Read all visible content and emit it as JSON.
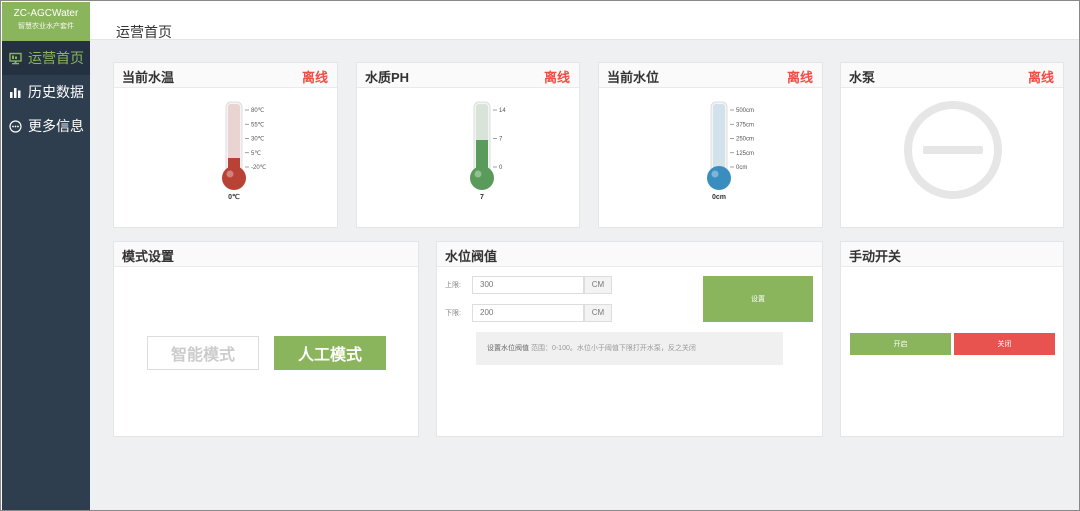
{
  "brand": {
    "title": "ZC-AGCWater",
    "subtitle": "智慧农业水产套件"
  },
  "sidebar": {
    "items": [
      {
        "label": "运营首页",
        "icon": "monitor-icon",
        "active": true
      },
      {
        "label": "历史数据",
        "icon": "bar-chart-icon",
        "active": false
      },
      {
        "label": "更多信息",
        "icon": "more-dots-icon",
        "active": false
      }
    ]
  },
  "header": {
    "page_title": "运营首页"
  },
  "colors": {
    "accent": "#8ab55c",
    "offline": "#f04e45",
    "sidebar": "#2f3e4f",
    "danger_button": "#e8534f"
  },
  "cards": {
    "temp": {
      "title": "当前水温",
      "status": "离线",
      "scale": [
        "80℃",
        "55℃",
        "30℃",
        "5℃",
        "-20℃"
      ],
      "value": "0℃",
      "fill_fraction": 0.2,
      "color": "#b94135"
    },
    "ph": {
      "title": "水质PH",
      "status": "离线",
      "scale": [
        "14",
        "7",
        "0"
      ],
      "value": "7",
      "fill_fraction": 0.5,
      "color": "#5a9a5a"
    },
    "level": {
      "title": "当前水位",
      "status": "离线",
      "scale": [
        "500cm",
        "375cm",
        "250cm",
        "125cm",
        "0cm"
      ],
      "value": "0cm",
      "fill_fraction": 0.0,
      "color": "#3a8dbf"
    },
    "pump": {
      "title": "水泵",
      "status": "离线"
    }
  },
  "mode": {
    "title": "模式设置",
    "smart_label": "智能模式",
    "manual_label": "人工模式"
  },
  "threshold": {
    "title": "水位阀值",
    "upper_label": "上限:",
    "upper_value": "300",
    "upper_unit": "CM",
    "lower_label": "下限:",
    "lower_value": "200",
    "lower_unit": "CM",
    "set_label": "设置",
    "tip_title": "设置水位阀值",
    "tip_text": "范围：0-100。水位小于阈值下限打开水泵，反之关闭"
  },
  "manual_switch": {
    "title": "手动开关",
    "on_label": "开启",
    "off_label": "关闭"
  }
}
